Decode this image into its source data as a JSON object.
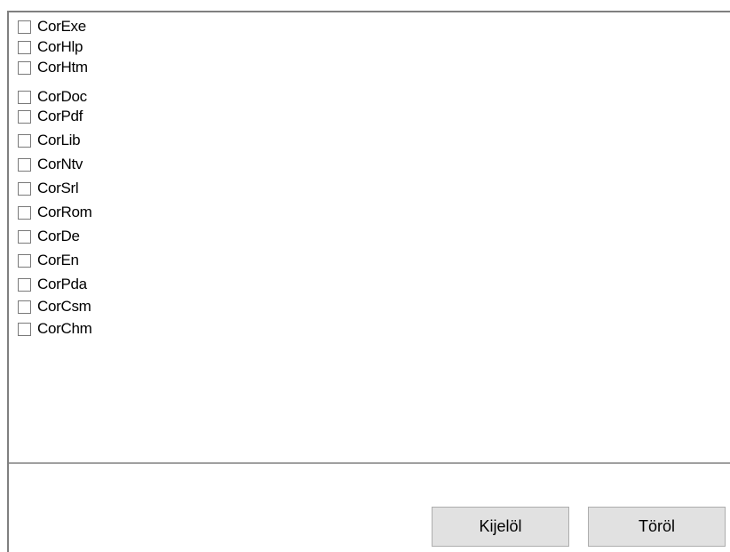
{
  "list": {
    "items": [
      {
        "label": "CorExe",
        "checked": false
      },
      {
        "label": "CorHlp",
        "checked": false
      },
      {
        "label": "CorHtm",
        "checked": false
      },
      {
        "label": "CorDoc",
        "checked": false
      },
      {
        "label": "CorPdf",
        "checked": false
      },
      {
        "label": "CorLib",
        "checked": false
      },
      {
        "label": "CorNtv",
        "checked": false
      },
      {
        "label": "CorSrl",
        "checked": false
      },
      {
        "label": "CorRom",
        "checked": false
      },
      {
        "label": "CorDe",
        "checked": false
      },
      {
        "label": "CorEn",
        "checked": false
      },
      {
        "label": "CorPda",
        "checked": false
      },
      {
        "label": "CorCsm",
        "checked": false
      },
      {
        "label": "CorChm",
        "checked": false
      }
    ]
  },
  "buttons": {
    "select_label": "Kijelöl",
    "delete_label": "Töröl"
  },
  "colors": {
    "button_face": "#e1e1e1",
    "button_border": "#adadad",
    "frame": "#808080"
  }
}
